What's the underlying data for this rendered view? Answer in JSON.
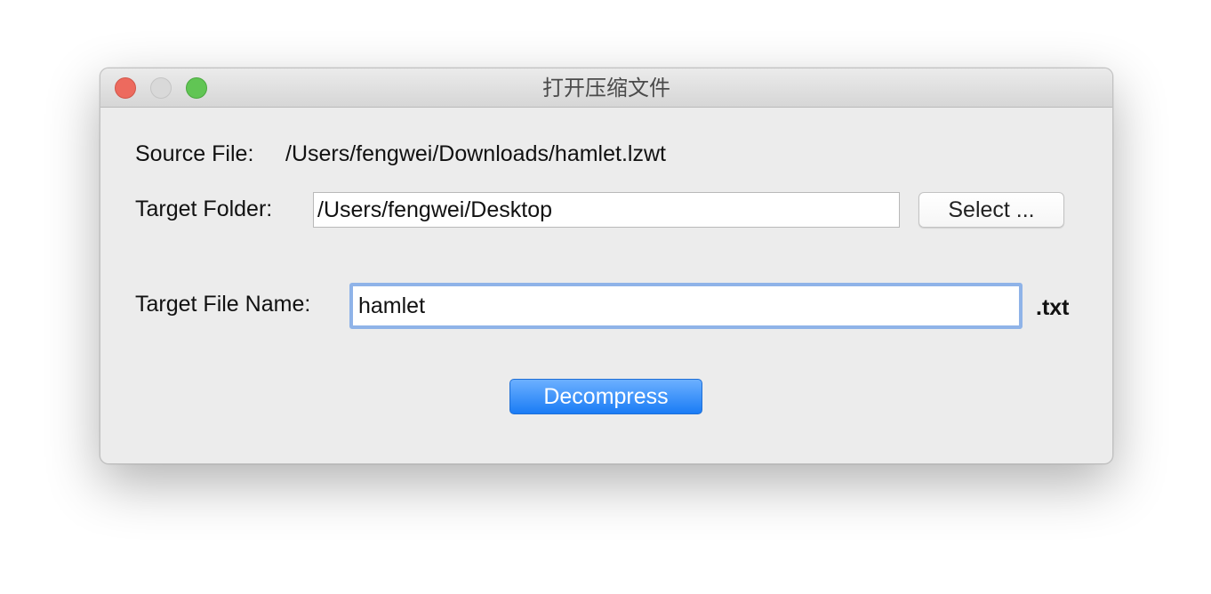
{
  "window": {
    "title": "打开压缩文件"
  },
  "source": {
    "label": "Source File:",
    "path": "/Users/fengwei/Downloads/hamlet.lzwt"
  },
  "target_folder": {
    "label": "Target Folder:",
    "value": "/Users/fengwei/Desktop",
    "select_label": "Select ..."
  },
  "target_file": {
    "label": "Target File Name:",
    "value": "hamlet",
    "extension": ".txt"
  },
  "actions": {
    "decompress_label": "Decompress"
  },
  "colors": {
    "accent": "#1a7cf5",
    "focus_ring": "#8fb3e8",
    "close": "#ed6a5e",
    "minimize": "#d9d9d9",
    "zoom": "#61c554"
  }
}
